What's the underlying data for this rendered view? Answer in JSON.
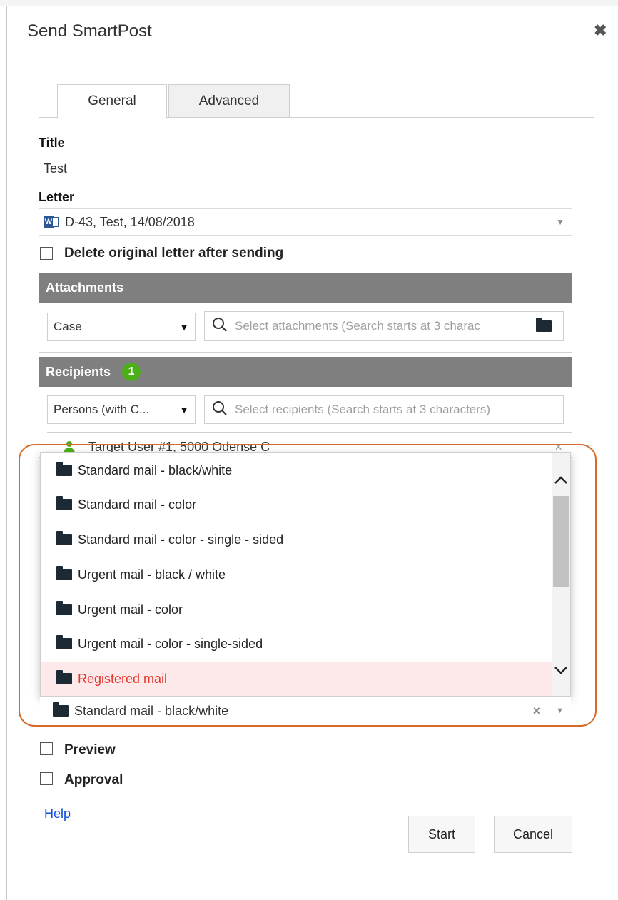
{
  "dialog": {
    "title": "Send SmartPost",
    "close_icon": "close-icon"
  },
  "tabs": [
    {
      "label": "General",
      "active": true
    },
    {
      "label": "Advanced",
      "active": false
    }
  ],
  "form": {
    "title_label": "Title",
    "title_value": "Test",
    "letter_label": "Letter",
    "letter_value": "D-43, Test, 14/08/2018",
    "letter_icon": "word-doc-icon",
    "delete_original_label": "Delete original letter after sending",
    "delete_original_checked": false
  },
  "attachments": {
    "header": "Attachments",
    "source_select": "Case",
    "search_placeholder": "Select attachments (Search starts at 3 charac"
  },
  "recipients": {
    "header": "Recipients",
    "count": "1",
    "type_select": "Persons (with C...",
    "search_placeholder": "Select recipients (Search starts at 3 characters)",
    "entries": [
      {
        "name": "Target User #1, 5000 Odense C"
      }
    ]
  },
  "shipping": {
    "options": [
      "Standard mail - black/white",
      "Standard mail - color",
      "Standard mail - color - single - sided",
      "Urgent mail - black / white",
      "Urgent mail - color",
      "Urgent mail - color - single-sided",
      "Registered mail"
    ],
    "highlighted_option": "Registered mail",
    "selected_value": "Standard mail - black/white",
    "clear_glyph": "×",
    "remove_glyph": "×"
  },
  "options": {
    "preview_label": "Preview",
    "approval_label": "Approval"
  },
  "footer": {
    "help_link": "Help",
    "start_label": "Start",
    "cancel_label": "Cancel"
  },
  "colors": {
    "section_header": "#7f7f7f",
    "badge": "#4caf1a",
    "highlight_border": "#d66a28",
    "selected_option_text": "#e5372c",
    "selected_option_bg": "#fde8ea",
    "link": "#0b4fd8"
  }
}
